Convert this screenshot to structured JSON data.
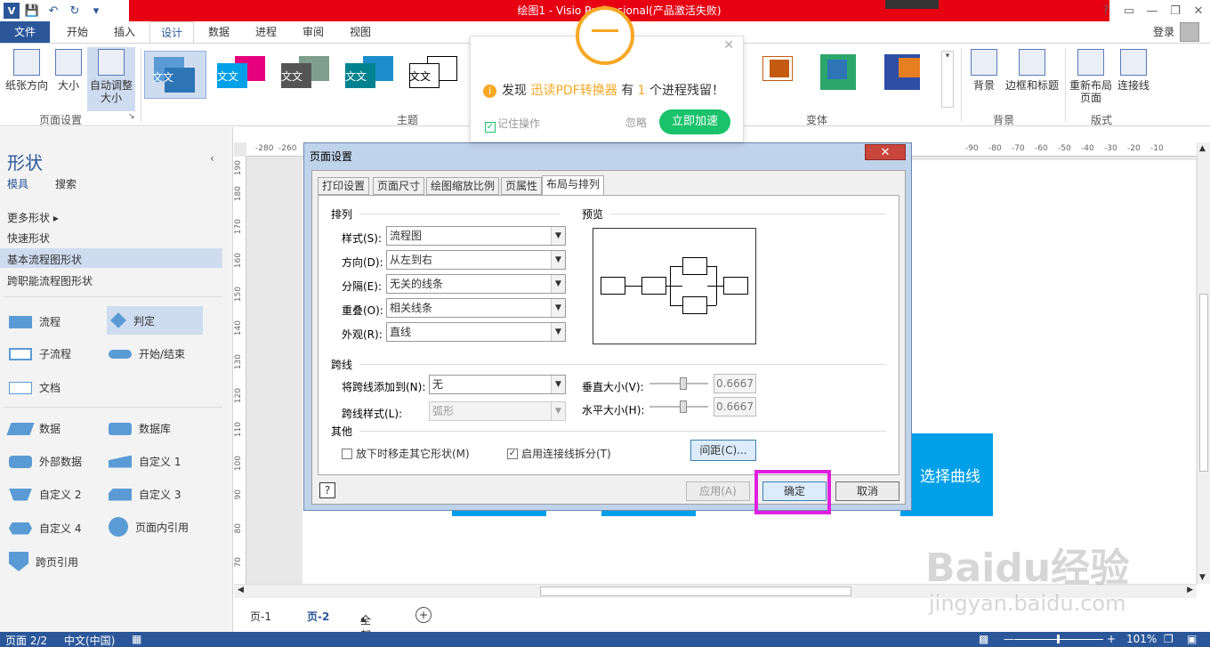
{
  "window": {
    "title": "绘图1 - Visio Professional(产品激活失败)"
  },
  "ribbon_tabs": {
    "file": "文件",
    "start": "开始",
    "insert": "插入",
    "design": "设计",
    "data": "数据",
    "process": "进程",
    "review": "审阅",
    "view": "视图",
    "login": "登录"
  },
  "ribbon": {
    "orientation": "纸张方向",
    "size": "大小",
    "autosize_l1": "自动调整",
    "autosize_l2": "大小",
    "group_page_setup": "页面设置",
    "group_themes": "主题",
    "group_variants": "变体",
    "background": "背景",
    "borders": "边框和标题",
    "relayout_l1": "重新布局",
    "relayout_l2": "页面",
    "connectors": "连接线",
    "group_background": "背景",
    "group_layout": "版式",
    "theme_label": "文文"
  },
  "sidebar": {
    "title": "形状",
    "tab_stencils": "模具",
    "tab_search": "搜索",
    "more_shapes": "更多形状",
    "quick_shapes": "快速形状",
    "basic_flowchart": "基本流程图形状",
    "cross_functional": "跨职能流程图形状",
    "shapes": [
      "流程",
      "判定",
      "子流程",
      "开始/结束",
      "文档",
      "数据",
      "数据库",
      "外部数据",
      "自定义 1",
      "自定义 2",
      "自定义 3",
      "自定义 4",
      "页面内引用",
      "跨页引用"
    ]
  },
  "popup": {
    "msg_pre": "发现",
    "msg_app": "迅读PDF转换器",
    "msg_mid": "有",
    "msg_count": "1",
    "msg_post": "个进程残留！",
    "remember": "记住操作",
    "ignore": "忽略",
    "accelerate": "立即加速"
  },
  "dialog": {
    "title": "页面设置",
    "tabs": [
      "打印设置",
      "页面尺寸",
      "绘图缩放比例",
      "页属性",
      "布局与排列"
    ],
    "sec_arrange": "排列",
    "sec_preview": "预览",
    "style_label": "样式(S):",
    "style_value": "流程图",
    "direction_label": "方向(D):",
    "direction_value": "从左到右",
    "separation_label": "分隔(E):",
    "separation_value": "无关的线条",
    "overlap_label": "重叠(O):",
    "overlap_value": "相关线条",
    "appearance_label": "外观(R):",
    "appearance_value": "直线",
    "sec_jump": "跨线",
    "add_jump_label": "将跨线添加到(N):",
    "add_jump_value": "无",
    "jump_style_label": "跨线样式(L):",
    "jump_style_value": "弧形",
    "vert_size_label": "垂直大小(V):",
    "vert_size_value": "0.6667",
    "horiz_size_label": "水平大小(H):",
    "horiz_size_value": "0.6667",
    "sec_other": "其他",
    "move_away": "放下时移走其它形状(M)",
    "split_connectors": "启用连接线拆分(T)",
    "spacing_btn": "间距(C)...",
    "apply_btn": "应用(A)",
    "ok_btn": "确定",
    "cancel_btn": "取消",
    "help": "?"
  },
  "canvas": {
    "curve_label": "选择曲线",
    "hruler": [
      "-280",
      "-260",
      "-90",
      "-80",
      "-70",
      "-60",
      "-50",
      "-40",
      "-30",
      "-20",
      "-10"
    ],
    "vruler": [
      "190",
      "180",
      "170",
      "160",
      "150",
      "140",
      "130",
      "120",
      "110",
      "100",
      "90",
      "80",
      "70"
    ]
  },
  "pagetabs": {
    "page1": "页-1",
    "page2": "页-2",
    "all": "全部"
  },
  "status": {
    "page": "页面 2/2",
    "lang": "中文(中国)",
    "zoom": "101%"
  },
  "watermark": {
    "logo": "Baidu经验",
    "url": "jingyan.baidu.com"
  }
}
